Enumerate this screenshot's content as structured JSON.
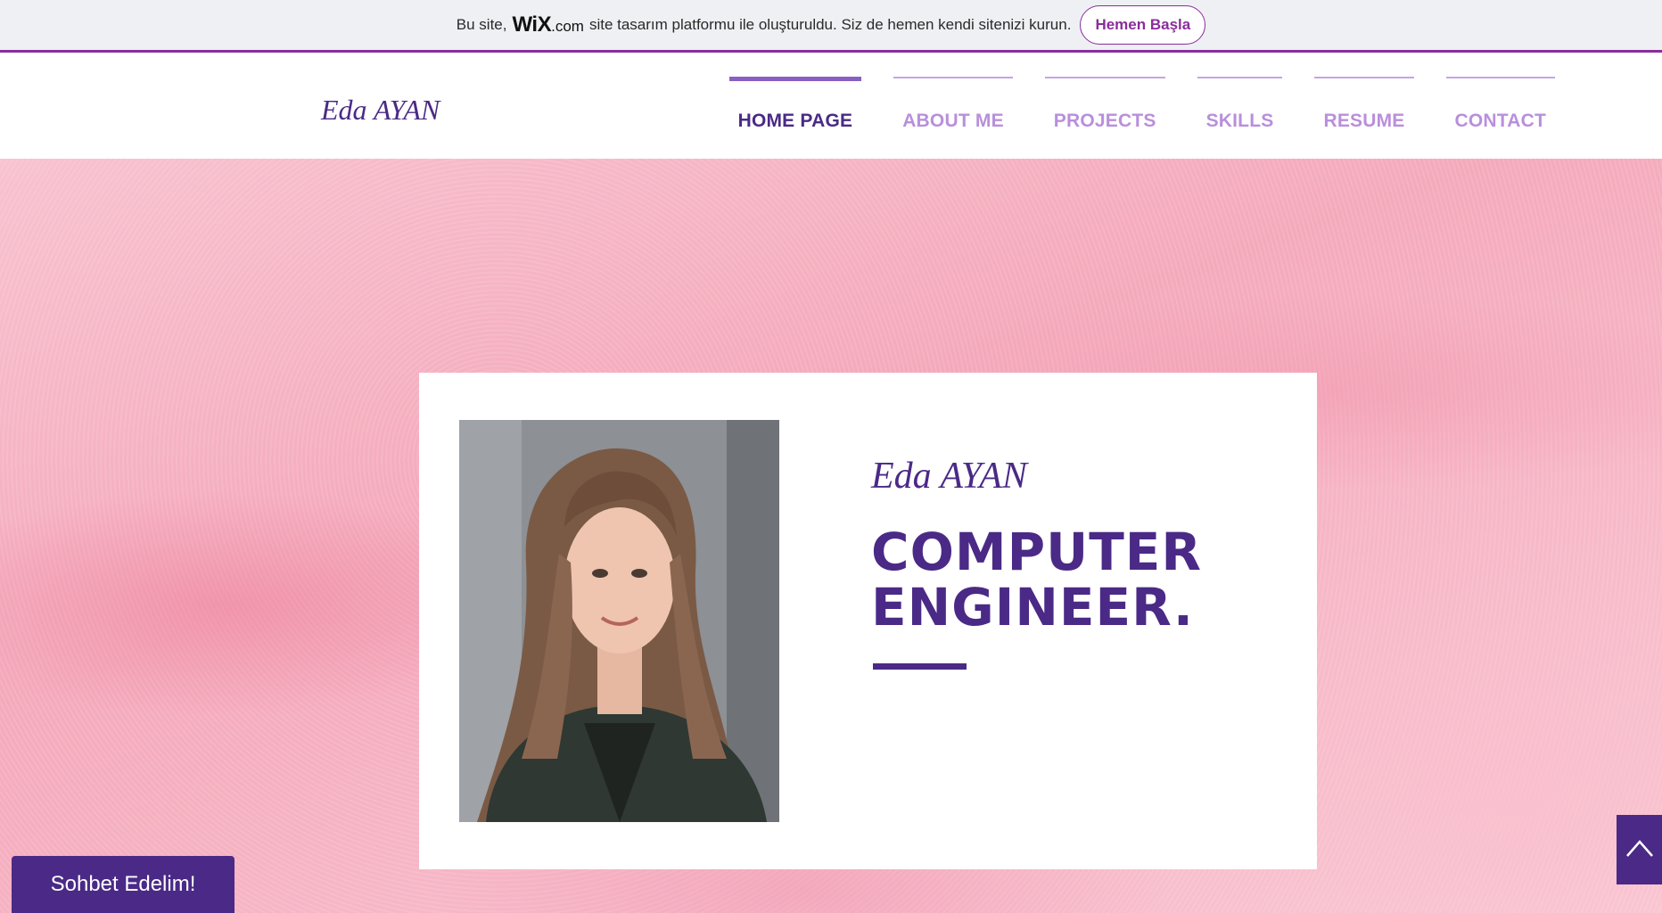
{
  "promo": {
    "text_before": "Bu site,",
    "wix_brand": "WiX",
    "wix_domain": ".com",
    "text_after": "site tasarım platformu ile oluşturuldu. Siz de hemen kendi sitenizi kurun.",
    "cta_label": "Hemen Başla"
  },
  "header": {
    "logo": "Eda AYAN",
    "nav": [
      {
        "label": "HOME PAGE",
        "active": true
      },
      {
        "label": "ABOUT ME",
        "active": false
      },
      {
        "label": "PROJECTS",
        "active": false
      },
      {
        "label": "SKILLS",
        "active": false
      },
      {
        "label": "RESUME",
        "active": false
      },
      {
        "label": "CONTACT",
        "active": false
      }
    ]
  },
  "hero": {
    "name": "Eda AYAN",
    "title_line1": "COMPUTER",
    "title_line2": "ENGINEER."
  },
  "chat": {
    "label": "Sohbet Edelim!"
  },
  "icons": {
    "back_to_top": "chevron-up-icon",
    "portrait": "profile-photo"
  },
  "colors": {
    "brand_purple": "#4a2a86",
    "nav_inactive": "#b98fdc",
    "promo_accent": "#8a2c9c",
    "hero_pink": "#f4a9bb"
  }
}
